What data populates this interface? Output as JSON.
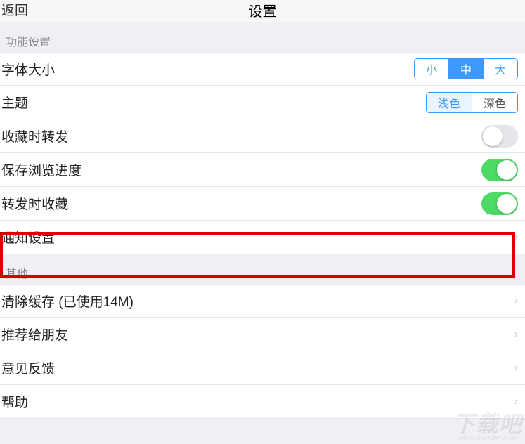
{
  "header": {
    "back": "返回",
    "title": "设置"
  },
  "sections": {
    "functional": {
      "title": "功能设置",
      "font_size": {
        "label": "字体大小",
        "options": {
          "small": "小",
          "medium": "中",
          "large": "大"
        },
        "selected": "medium"
      },
      "theme": {
        "label": "主题",
        "options": {
          "light": "浅色",
          "dark": "深色"
        },
        "selected": "light"
      },
      "forward_on_fav": {
        "label": "收藏时转发",
        "value": false
      },
      "save_progress": {
        "label": "保存浏览进度",
        "value": true
      },
      "fav_on_forward": {
        "label": "转发时收藏",
        "value": true
      },
      "notification": {
        "label": "通知设置"
      }
    },
    "other": {
      "title": "其他",
      "clear_cache": {
        "label": "清除缓存   (已使用14M)"
      },
      "recommend": {
        "label": "推荐给朋友"
      },
      "feedback": {
        "label": "意见反馈"
      },
      "help": {
        "label": "帮助"
      }
    }
  },
  "watermark": {
    "main": "下载吧",
    "sub": "www.xiazaiba.com"
  }
}
